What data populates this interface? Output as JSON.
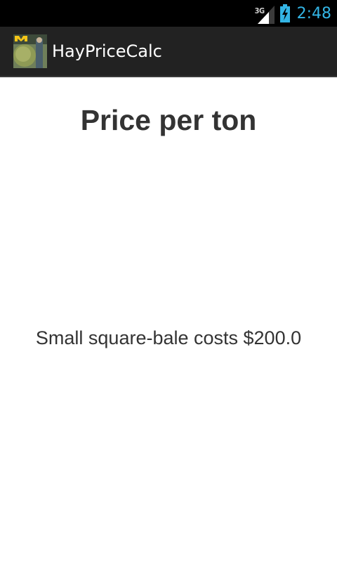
{
  "status_bar": {
    "network_type": "3G",
    "time": "2:48",
    "signal_icon": "signal-bars-icon",
    "battery_icon": "battery-charging-icon",
    "clock_color": "#33b5e5"
  },
  "action_bar": {
    "title": "HayPriceCalc",
    "icon": "app-icon-hay-bale"
  },
  "content": {
    "heading": "Price per ton",
    "result_text": "Small square-bale costs $200.0"
  }
}
